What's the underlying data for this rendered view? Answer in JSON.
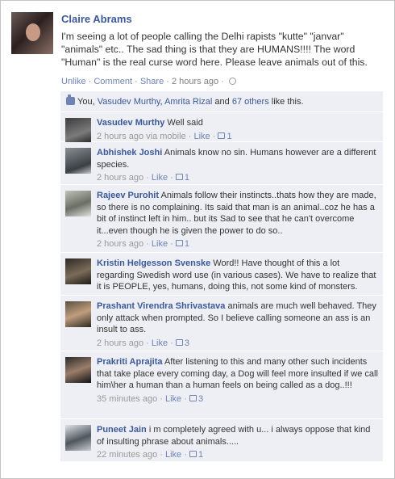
{
  "post": {
    "author": "Claire Abrams",
    "text": "I'm seeing a lot of people calling the Delhi rapists \"kutte\" \"janvar\" \"animals\" etc.. The sad thing is that they are HUMANS!!!! The word \"Human\" is the real curse word here. Please leave animals out of this.",
    "unlike": "Unlike",
    "comment": "Comment",
    "share": "Share",
    "time": "2 hours ago",
    "sep": " · "
  },
  "likes": {
    "you": "You, ",
    "user1": "Vasudev Murthy",
    "comma": ", ",
    "user2": "Amrita Rizal",
    "and": " and ",
    "others": "67 others",
    "tail": " like this."
  },
  "comments": [
    {
      "author": "Vasudev Murthy",
      "text": "Well said",
      "time": "2 hours ago via mobile",
      "like": "Like",
      "count": "1"
    },
    {
      "author": "Abhishek Joshi",
      "text": "Animals know no sin. Humans however are a different species.",
      "time": "2 hours ago",
      "like": "Like",
      "count": "1"
    },
    {
      "author": "Rajeev Purohit",
      "text": "Animals follow their instincts..thats how they are made, so there is no complaining. Its said that man is an animal..coz he has a bit of instinct left in him.. but its Sad to see that he can't overcome it...even though he is given the power to do so..",
      "time": "2 hours ago",
      "like": "Like",
      "count": "1"
    },
    {
      "author": "Kristin Helgesson Svenske",
      "text": "Word!! Have thought of this a lot regarding Swedish word use (in various cases). We have to realize that it is PEOPLE, yes, humans, doing this, not some kind of monsters.",
      "time": "2 hours ago via mobile",
      "like": "Like",
      "count": "1"
    },
    {
      "author": "Prashant Virendra Shrivastava",
      "text": "animals are much well behaved. They only attack when prompted. So I believe calling someone an ass is an insult to ass.",
      "time": "2 hours ago",
      "like": "Like",
      "count": "3"
    },
    {
      "author": "Prakriti Aprajita",
      "text": "After listening to this and many other such incidents that take place every coming day, a Dog will feel more insulted if we call him\\her a human than a human feels on being called as a dog..!!!",
      "time": "35 minutes ago",
      "like": "Like",
      "count": "3"
    },
    {
      "author": "Puneet Jain",
      "text": "i m completely agreed with u... i always oppose that kind of insulting phrase about animals.....",
      "time": "22 minutes ago",
      "like": "Like",
      "count": "1"
    }
  ],
  "colors": {
    "link": "#3b5998",
    "meta_link": "#6d84b4",
    "comment_bg": "#edeff4"
  }
}
